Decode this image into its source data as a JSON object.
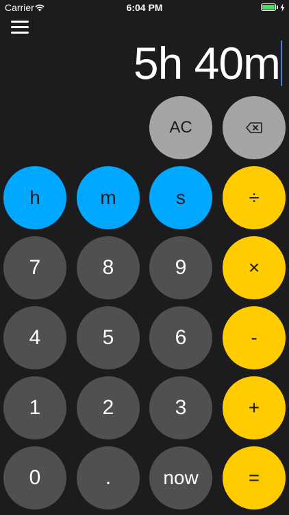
{
  "status_bar": {
    "carrier": "Carrier",
    "time": "6:04 PM",
    "battery_level": 1.0
  },
  "display": {
    "value": "5h 40m"
  },
  "keys": {
    "ac": "AC",
    "hours": "h",
    "minutes": "m",
    "seconds": "s",
    "divide": "÷",
    "multiply": "×",
    "subtract": "-",
    "add": "+",
    "equals": "=",
    "seven": "7",
    "eight": "8",
    "nine": "9",
    "four": "4",
    "five": "5",
    "six": "6",
    "one": "1",
    "two": "2",
    "three": "3",
    "zero": "0",
    "decimal": ".",
    "now": "now"
  },
  "icons": {
    "menu": "hamburger-menu-icon",
    "delete": "backspace-icon"
  },
  "colors": {
    "background": "#1c1c1e",
    "unit_key": "#00a8ff",
    "operator_key": "#ffcc00",
    "number_key": "#505050",
    "function_key": "#a5a5a5",
    "cursor": "#3f7bff"
  }
}
